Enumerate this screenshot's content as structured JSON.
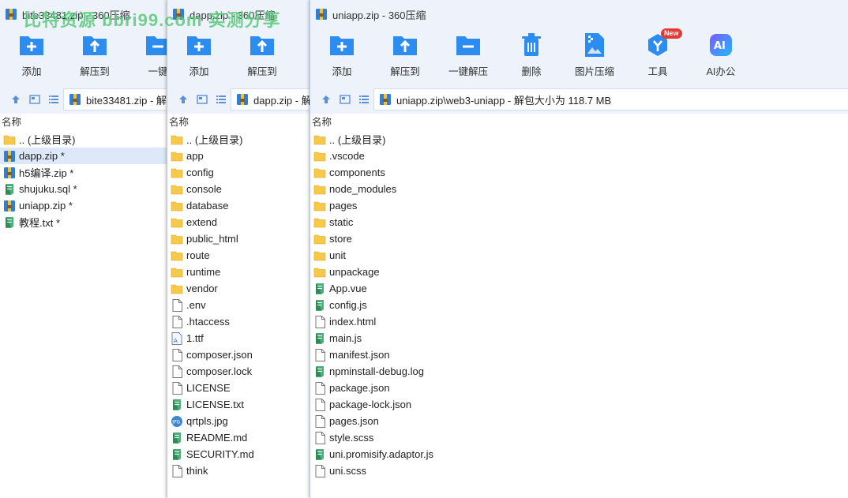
{
  "watermark": "比特资源 bbri99.com 实测分享",
  "windows": [
    {
      "title": "bite33481.zip - 360压缩",
      "toolbar": [
        "添加",
        "解压到",
        "一键"
      ],
      "path": "bite33481.zip - 解",
      "column_header": "名称",
      "items": [
        {
          "name": ".. (上级目录)",
          "icon": "folder-icon"
        },
        {
          "name": "dapp.zip *",
          "icon": "zip-archive-icon",
          "selected": true
        },
        {
          "name": "h5编译.zip *",
          "icon": "zip-archive-icon"
        },
        {
          "name": "shujuku.sql *",
          "icon": "green-file-icon"
        },
        {
          "name": "uniapp.zip *",
          "icon": "zip-archive-icon"
        },
        {
          "name": "教程.txt *",
          "icon": "green-file-icon"
        }
      ]
    },
    {
      "title": "dapp.zip - 360压缩",
      "toolbar": [
        "添加",
        "解压到"
      ],
      "path": "dapp.zip - 解",
      "column_header": "名称",
      "items": [
        {
          "name": ".. (上级目录)",
          "icon": "folder-icon"
        },
        {
          "name": "app",
          "icon": "folder-icon"
        },
        {
          "name": "config",
          "icon": "folder-icon"
        },
        {
          "name": "console",
          "icon": "folder-icon"
        },
        {
          "name": "database",
          "icon": "folder-icon"
        },
        {
          "name": "extend",
          "icon": "folder-icon"
        },
        {
          "name": "public_html",
          "icon": "folder-icon"
        },
        {
          "name": "route",
          "icon": "folder-icon"
        },
        {
          "name": "runtime",
          "icon": "folder-icon"
        },
        {
          "name": "vendor",
          "icon": "folder-icon"
        },
        {
          "name": ".env",
          "icon": "blank-file-icon"
        },
        {
          "name": ".htaccess",
          "icon": "blank-file-icon"
        },
        {
          "name": "1.ttf",
          "icon": "font-file-icon"
        },
        {
          "name": "composer.json",
          "icon": "blank-file-icon"
        },
        {
          "name": "composer.lock",
          "icon": "blank-file-icon"
        },
        {
          "name": "LICENSE",
          "icon": "blank-file-icon"
        },
        {
          "name": "LICENSE.txt",
          "icon": "green-file-icon"
        },
        {
          "name": "qrtpls.jpg",
          "icon": "jpg-file-icon"
        },
        {
          "name": "README.md",
          "icon": "green-file-icon"
        },
        {
          "name": "SECURITY.md",
          "icon": "green-file-icon"
        },
        {
          "name": "think",
          "icon": "blank-file-icon"
        }
      ]
    },
    {
      "title": "uniapp.zip - 360压缩",
      "toolbar": [
        "添加",
        "解压到",
        "一键解压",
        "删除",
        "图片压缩",
        "工具",
        "AI办公"
      ],
      "new_badge": "New",
      "path": "uniapp.zip\\web3-uniapp - 解包大小为 118.7 MB",
      "column_header": "名称",
      "items": [
        {
          "name": ".. (上级目录)",
          "icon": "folder-icon"
        },
        {
          "name": ".vscode",
          "icon": "folder-icon"
        },
        {
          "name": "components",
          "icon": "folder-icon"
        },
        {
          "name": "node_modules",
          "icon": "folder-icon"
        },
        {
          "name": "pages",
          "icon": "folder-icon"
        },
        {
          "name": "static",
          "icon": "folder-icon"
        },
        {
          "name": "store",
          "icon": "folder-icon"
        },
        {
          "name": "unit",
          "icon": "folder-icon"
        },
        {
          "name": "unpackage",
          "icon": "folder-icon"
        },
        {
          "name": "App.vue",
          "icon": "green-file-icon"
        },
        {
          "name": "config.js",
          "icon": "green-file-icon"
        },
        {
          "name": "index.html",
          "icon": "blank-file-icon"
        },
        {
          "name": "main.js",
          "icon": "green-file-icon"
        },
        {
          "name": "manifest.json",
          "icon": "blank-file-icon"
        },
        {
          "name": "npminstall-debug.log",
          "icon": "green-file-icon"
        },
        {
          "name": "package.json",
          "icon": "blank-file-icon"
        },
        {
          "name": "package-lock.json",
          "icon": "blank-file-icon"
        },
        {
          "name": "pages.json",
          "icon": "blank-file-icon"
        },
        {
          "name": "style.scss",
          "icon": "blank-file-icon"
        },
        {
          "name": "uni.promisify.adaptor.js",
          "icon": "green-file-icon"
        },
        {
          "name": "uni.scss",
          "icon": "blank-file-icon"
        }
      ]
    }
  ],
  "colors": {
    "folder": "#f7c948",
    "accent_blue": "#2d8cf0",
    "selected_row": "#dde9f8",
    "watermark": "#59c97a"
  }
}
